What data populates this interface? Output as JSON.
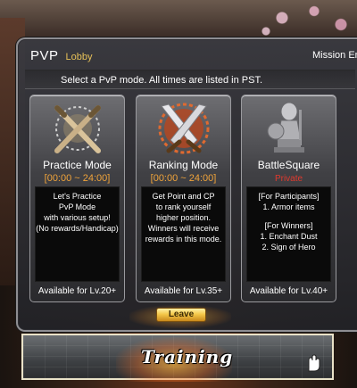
{
  "window": {
    "title": "PVP",
    "subtitle": "Lobby",
    "mission_tab": "Mission En"
  },
  "info": "Select a PvP mode.  All times are listed in PST.",
  "modes": [
    {
      "name": "Practice Mode",
      "time": "[00:00 ~ 24:00]",
      "icon": "crossed-bats-icon",
      "description": [
        "Let's Practice",
        "PvP Mode",
        "with various setup!",
        "(No rewards/Handicap)"
      ],
      "availability": "Available for Lv.20+"
    },
    {
      "name": "Ranking Mode",
      "time": "[00:00 ~ 24:00]",
      "icon": "crossed-swords-icon",
      "description": [
        "Get Point and CP",
        "to rank yourself",
        "higher position.",
        "Winners will receive",
        "rewards in this mode."
      ],
      "availability": "Available for Lv.35+"
    },
    {
      "name": "BattleSquare",
      "time": "Private",
      "icon": "knight-statue-icon",
      "description_a": [
        "[For Participants]",
        "1. Armor items"
      ],
      "description_b": [
        "[For Winners]",
        "1. Enchant Dust",
        "2. Sign of Hero"
      ],
      "availability": "Available for Lv.40+"
    }
  ],
  "leave_label": "Leave",
  "training_label": "Training",
  "colors": {
    "accent_gold": "#e7c158",
    "time_orange": "#f0a33a",
    "private_red": "#e03a2e"
  }
}
